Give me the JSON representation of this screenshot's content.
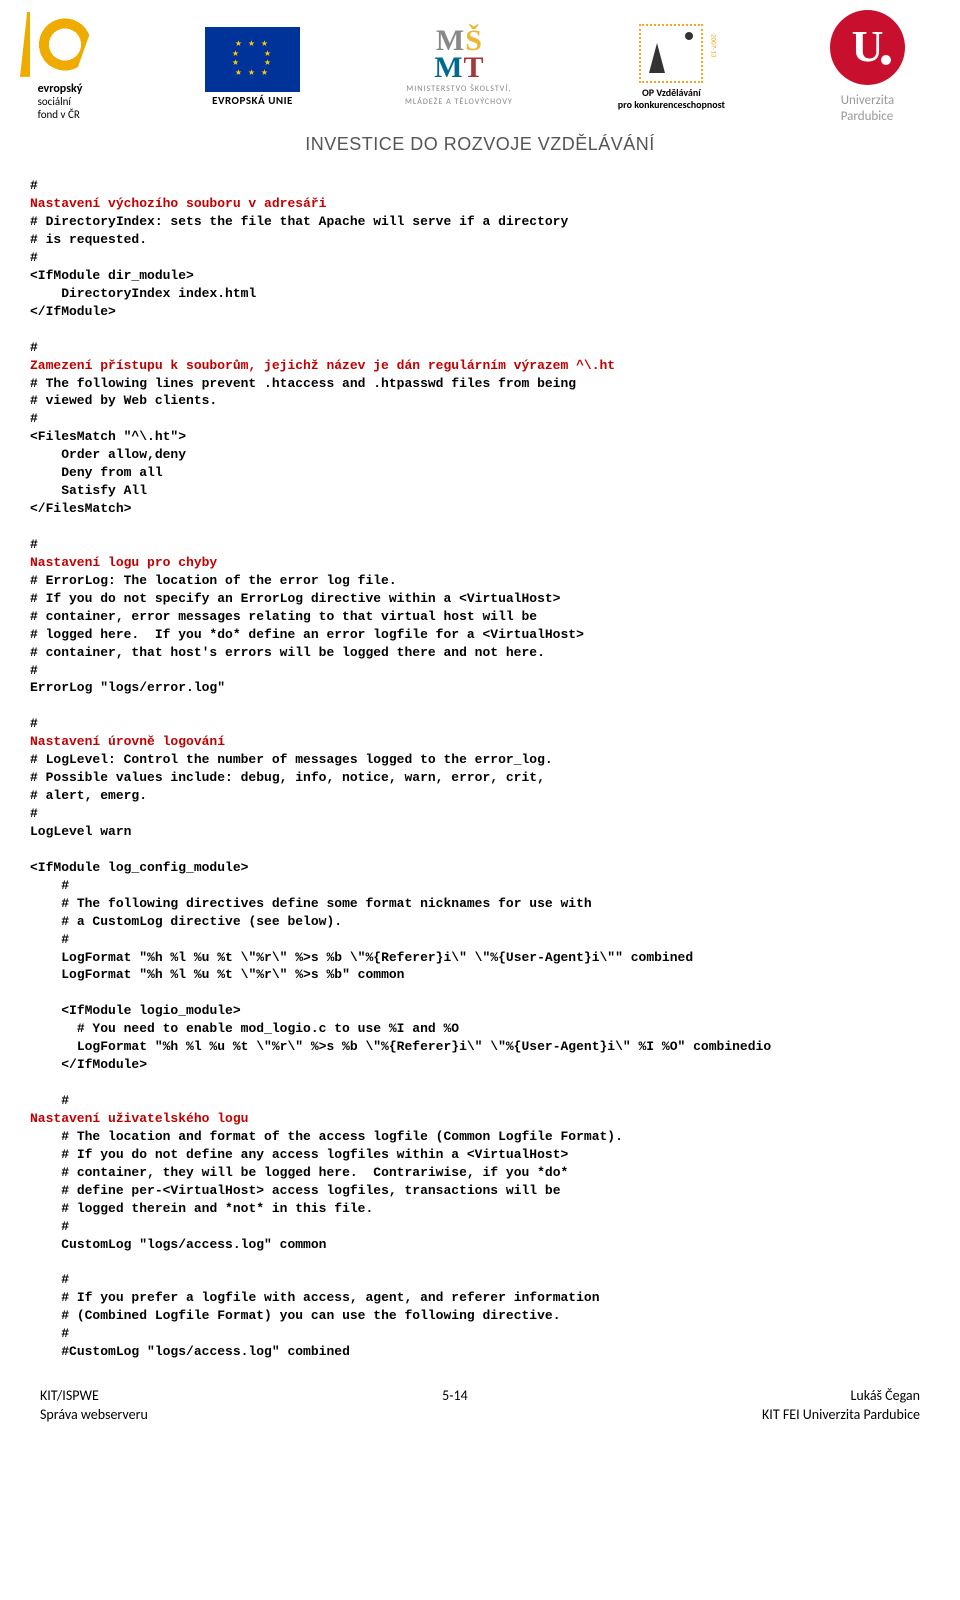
{
  "logos": {
    "esf": {
      "line1": "evropský",
      "line2": "sociální",
      "line3": "fond v ČR"
    },
    "eu": {
      "label": "EVROPSKÁ UNIE"
    },
    "msmt": {
      "line1": "MINISTERSTVO ŠKOLSTVÍ,",
      "line2": "MLÁDEŽE A TĚLOVÝCHOVY"
    },
    "op": {
      "line1": "OP Vzdělávání",
      "line2": "pro konkurenceschopnost",
      "num": "2007-13"
    },
    "uni": {
      "line1": "Univerzita",
      "line2": "Pardubice"
    }
  },
  "invest": "INVESTICE DO ROZVOJE VZDĚLÁVÁNÍ",
  "s": {
    "h": "#",
    "dir_title": "Nastavení výchozího souboru v adresáři",
    "dir_c1": "# DirectoryIndex: sets the file that Apache will serve if a directory",
    "dir_c2": "# is requested.",
    "dir_l1": "<IfModule dir_module>",
    "dir_l2": "    DirectoryIndex index.html",
    "dir_l3": "</IfModule>",
    "fm_title": "Zamezení přístupu k souborům, jejichž název je dán regulárním výrazem ^\\.ht",
    "fm_c1": "# The following lines prevent .htaccess and .htpasswd files from being",
    "fm_c2": "# viewed by Web clients.",
    "fm_l1": "<FilesMatch \"^\\.ht\">",
    "fm_l2": "    Order allow,deny",
    "fm_l3": "    Deny from all",
    "fm_l4": "    Satisfy All",
    "fm_l5": "</FilesMatch>",
    "el_title": "Nastavení logu pro chyby",
    "el_c1": "# ErrorLog: The location of the error log file.",
    "el_c2": "# If you do not specify an ErrorLog directive within a <VirtualHost>",
    "el_c3": "# container, error messages relating to that virtual host will be",
    "el_c4": "# logged here.  If you *do* define an error logfile for a <VirtualHost>",
    "el_c5": "# container, that host's errors will be logged there and not here.",
    "el_l1": "ErrorLog \"logs/error.log\"",
    "ll_title": "Nastavení úrovně logování",
    "ll_c1": "# LogLevel: Control the number of messages logged to the error_log.",
    "ll_c2": "# Possible values include: debug, info, notice, warn, error, crit,",
    "ll_c3": "# alert, emerg.",
    "ll_l1": "LogLevel warn",
    "lc_l1": "<IfModule log_config_module>",
    "lc_h1": "    #",
    "lc_c1": "    # The following directives define some format nicknames for use with",
    "lc_c2": "    # a CustomLog directive (see below).",
    "lc_l2": "    LogFormat \"%h %l %u %t \\\"%r\\\" %>s %b \\\"%{Referer}i\\\" \\\"%{User-Agent}i\\\"\" combined",
    "lc_l3": "    LogFormat \"%h %l %u %t \\\"%r\\\" %>s %b\" common",
    "lc_l4": "    <IfModule logio_module>",
    "lc_c3": "      # You need to enable mod_logio.c to use %I and %O",
    "lc_l5": "      LogFormat \"%h %l %u %t \\\"%r\\\" %>s %b \\\"%{Referer}i\\\" \\\"%{User-Agent}i\\\" %I %O\" combinedio",
    "lc_l6": "    </IfModule>",
    "ul_title": "Nastavení uživatelského logu",
    "ul_c1": "    # The location and format of the access logfile (Common Logfile Format).",
    "ul_c2": "    # If you do not define any access logfiles within a <VirtualHost>",
    "ul_c3": "    # container, they will be logged here.  Contrariwise, if you *do*",
    "ul_c4": "    # define per-<VirtualHost> access logfiles, transactions will be",
    "ul_c5": "    # logged therein and *not* in this file.",
    "ul_l1": "    CustomLog \"logs/access.log\" common",
    "ul_c6": "    # If you prefer a logfile with access, agent, and referer information",
    "ul_c7": "    # (Combined Logfile Format) you can use the following directive.",
    "ul_l2": "    #CustomLog \"logs/access.log\" combined"
  },
  "footer": {
    "left1": "KIT/ISPWE",
    "left2": "Správa webserveru",
    "center": "5-14",
    "right1": "Lukáš Čegan",
    "right2": "KIT FEI Univerzita Pardubice"
  }
}
